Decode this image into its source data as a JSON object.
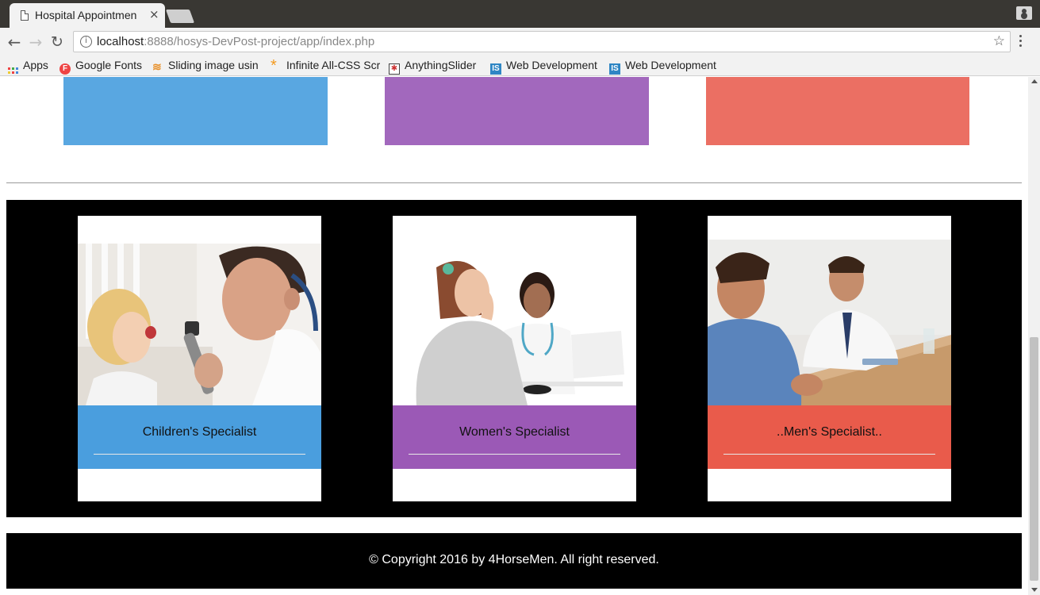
{
  "browser": {
    "tab_title": "Hospital Appointmen",
    "tab_close": "×",
    "url_host": "localhost",
    "url_rest": ":8888/hosys-DevPost-project/app/index.php",
    "bookmarks": [
      "Apps",
      "Google Fonts",
      "Sliding image usin",
      "Infinite All-CSS Scr",
      "AnythingSlider",
      "Web Development",
      "Web Development"
    ]
  },
  "colors": {
    "blue": "#59a7e1",
    "purple": "#a268bd",
    "red": "#eb6f63",
    "band_blue": "#4a9ede",
    "band_purple": "#9b59b6",
    "band_red": "#e95b4b"
  },
  "services": [
    {
      "label": "Children's Specialist",
      "photo": "doctor-examining-child"
    },
    {
      "label": "Women's Specialist",
      "photo": "female-doctor-with-patient"
    },
    {
      "label": "..Men's Specialist..",
      "photo": "doctor-consulting-man"
    }
  ],
  "footer": {
    "copyright": "© Copyright 2016 by 4HorseMen. All right reserved."
  }
}
